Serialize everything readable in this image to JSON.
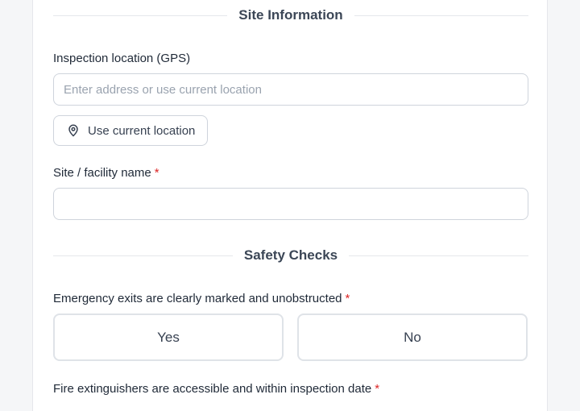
{
  "sections": {
    "site_information": "Site Information",
    "safety_checks": "Safety Checks"
  },
  "fields": {
    "gps_label": "Inspection location (GPS)",
    "gps_placeholder": "Enter address or use current location",
    "use_location_button": "Use current location",
    "site_name_label": "Site / facility name",
    "required_marker": "*"
  },
  "questions": {
    "exits_label": "Emergency exits are clearly marked and unobstructed",
    "yes_label": "Yes",
    "no_label": "No",
    "extinguishers_label": "Fire extinguishers are accessible and within inspection date"
  },
  "icons": {
    "location": "map-pin-icon"
  },
  "colors": {
    "required": "#dc2626",
    "border": "#cfd4dc"
  }
}
